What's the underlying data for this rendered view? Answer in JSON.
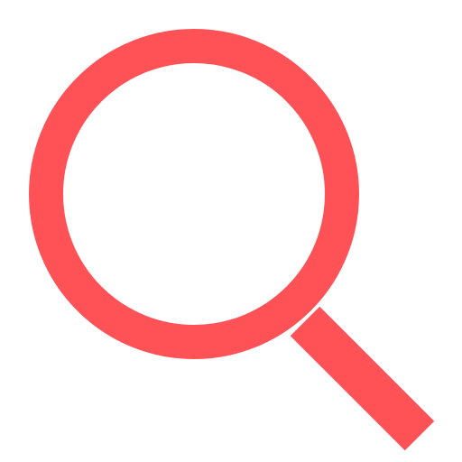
{
  "icon": {
    "name": "search-icon",
    "color": "#FF5257",
    "background": "#FFFFFF"
  }
}
